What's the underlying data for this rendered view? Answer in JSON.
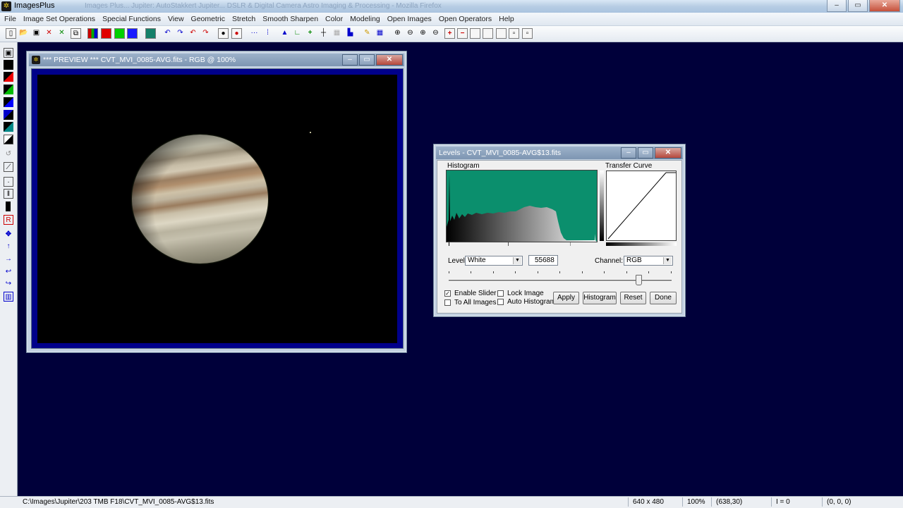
{
  "app": {
    "title": "ImagesPlus",
    "ghost_title": "Images Plus...  Jupiter: AutoStakkert Jupiter...  DSLR & Digital Camera Astro Imaging & Processing - Mozilla Firefox",
    "icon": "imagesplus-logo-icon"
  },
  "window_controls": {
    "minimize": "–",
    "restore": "▭",
    "close": "✕"
  },
  "menu": [
    "File",
    "Image Set Operations",
    "Special Functions",
    "View",
    "Geometric",
    "Stretch",
    "Smooth Sharpen",
    "Color",
    "Modeling",
    "Open Images",
    "Open Operators",
    "Help"
  ],
  "toolbar_icons": [
    "new-icon",
    "open-icon",
    "save-icon",
    "close-image-icon",
    "close-all-icon",
    "copy-icon",
    "rgb-channels-icon",
    "red-channel-icon",
    "green-channel-icon",
    "blue-channel-icon",
    "luminance-icon",
    "undo-icon",
    "redo-icon",
    "undo-all-icon",
    "redo-all-icon",
    "circle-select-icon",
    "circle-red-icon",
    "line-profile-icon",
    "star-profile-icon",
    "histogram-icon",
    "levels-icon",
    "add-icon",
    "crosshair-icon",
    "grid-icon",
    "paint-icon",
    "pencil-icon",
    "table-icon",
    "zoom-in-icon",
    "zoom-out-icon",
    "zoom-fit-icon",
    "zoom-actual-icon",
    "zoom-plus-icon",
    "zoom-minus-icon",
    "frame-1-icon",
    "frame-2-icon",
    "frame-3-icon",
    "frame-4-icon",
    "frame-5-icon"
  ],
  "left_tools": [
    "save-tool-icon",
    "black-square-icon",
    "red-fill-icon",
    "green-fill-icon",
    "blue-fill-icon",
    "dark-blue-icon",
    "teal-icon",
    "black-white-icon",
    "rotate-icon",
    "pen-icon",
    "select-box-icon",
    "bars-icon",
    "black-bar-icon",
    "red-select-icon",
    "move-icon",
    "arrow-up-icon",
    "arrow-right-icon",
    "arrow-back-icon",
    "arrow-down-icon",
    "grid-small-icon"
  ],
  "preview_window": {
    "title": "*** PREVIEW *** CVT_MVI_0085-AVG.fits - RGB @ 100%",
    "image_alt": "Jupiter planet preview"
  },
  "levels_window": {
    "title": "Levels - CVT_MVI_0085-AVG$13.fits",
    "histogram_label": "Histogram",
    "transfer_curve_label": "Transfer Curve",
    "level_label": "Level:",
    "level_value": "White",
    "value_field": "55688",
    "channel_label": "Channel:",
    "channel_value": "RGB",
    "enable_slider_label": "Enable Slider",
    "enable_slider_checked": true,
    "to_all_images_label": "To All Images",
    "to_all_images_checked": false,
    "lock_image_label": "Lock Image",
    "lock_image_checked": false,
    "auto_histogram_label": "Auto Histogram",
    "auto_histogram_checked": false,
    "buttons": {
      "apply": "Apply",
      "histogram": "Histogram",
      "reset": "Reset",
      "done": "Done"
    },
    "slider_level": 0.85
  },
  "status": {
    "path": "C:\\Images\\Jupiter\\203 TMB F18\\CVT_MVI_0085-AVG$13.fits",
    "dimensions": "640 x 480",
    "zoom": "100%",
    "cursor": "(638,30)",
    "intensity": "I = 0",
    "rgb": "(0, 0, 0)"
  },
  "colors": {
    "workspace": "#00003a",
    "histogram_fill": "#0b8f6d",
    "preview_border": "#00008a"
  }
}
